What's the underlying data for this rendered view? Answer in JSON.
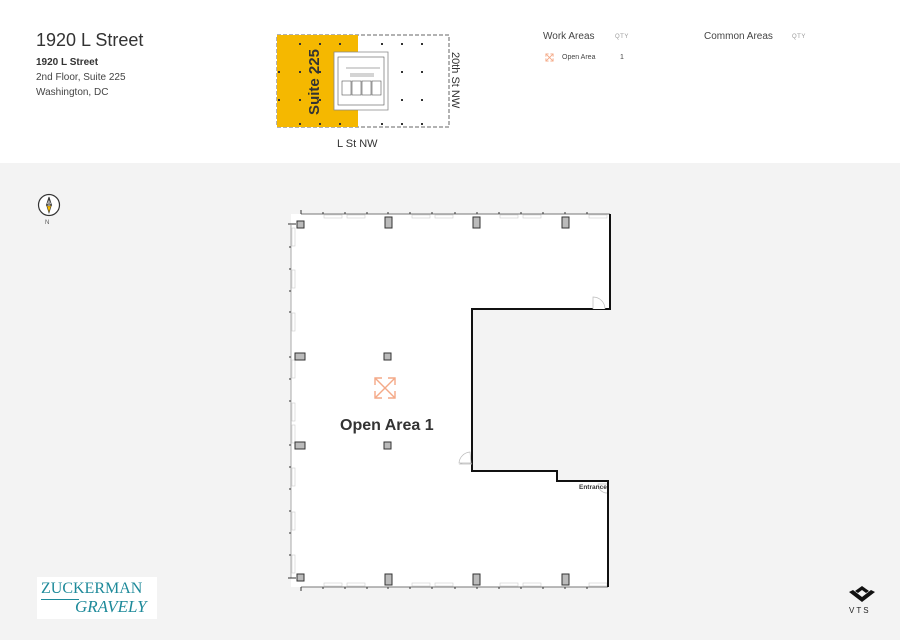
{
  "header": {
    "title": "1920 L Street",
    "address_line1": "1920 L Street",
    "address_line2": "2nd Floor, Suite 225",
    "address_line3": "Washington, DC"
  },
  "keyplan": {
    "suite_label": "Suite 225",
    "street_right": "20th St NW",
    "street_bottom": "L St NW",
    "highlight_color": "#f5b800"
  },
  "legend": {
    "work_areas": {
      "heading": "Work Areas",
      "qty_label": "QTY",
      "items": [
        {
          "icon": "open-area-icon",
          "label": "Open Area",
          "qty": "1",
          "color": "#f4a987"
        }
      ]
    },
    "common_areas": {
      "heading": "Common Areas",
      "qty_label": "QTY",
      "items": []
    }
  },
  "compass": {
    "label": "N",
    "accent": "#f5b800"
  },
  "plan": {
    "area_label": "Open Area 1",
    "entrance_label": "Entrance",
    "area_icon_color": "#f4a987"
  },
  "logos": {
    "broker_line1": "ZUCKERMAN",
    "broker_line2": "GRAVELY",
    "platform": "VTS"
  }
}
